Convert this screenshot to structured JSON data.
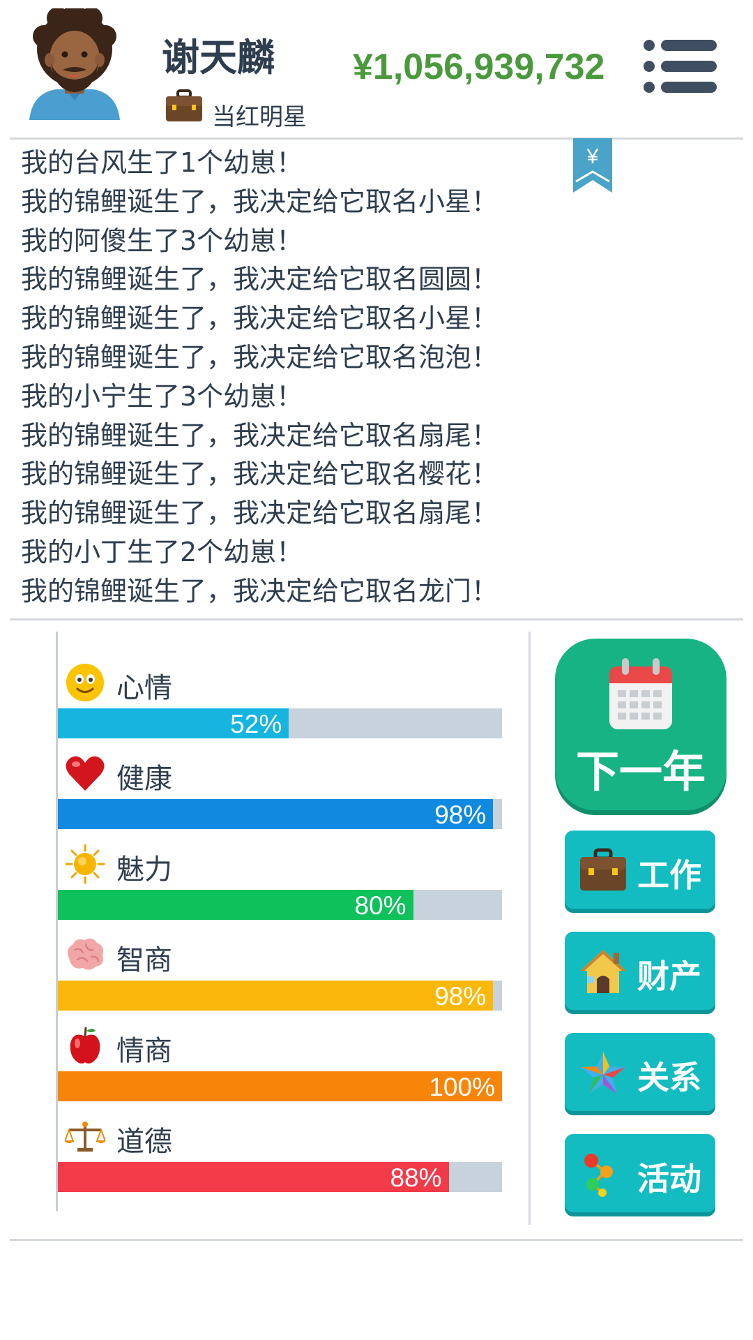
{
  "header": {
    "player_name": "谢天麟",
    "job_title": "当红明星",
    "money": "¥1,056,939,732",
    "avatar_icon": "avatar-icon",
    "job_icon": "briefcase-icon",
    "menu_icon": "menu-icon"
  },
  "log": {
    "bookmark_symbol": "¥",
    "lines": [
      "我的台风生了1个幼崽！",
      "我的锦鲤诞生了，我决定给它取名小星！",
      "我的阿傻生了3个幼崽！",
      "我的锦鲤诞生了，我决定给它取名圆圆！",
      "我的锦鲤诞生了，我决定给它取名小星！",
      "我的锦鲤诞生了，我决定给它取名泡泡！",
      "我的小宁生了3个幼崽！",
      "我的锦鲤诞生了，我决定给它取名扇尾！",
      "我的锦鲤诞生了，我决定给它取名樱花！",
      "我的锦鲤诞生了，我决定给它取名扇尾！",
      "我的小丁生了2个幼崽！",
      "我的锦鲤诞生了，我决定给它取名龙门！"
    ]
  },
  "stats": [
    {
      "label": "心情",
      "value": 52,
      "value_text": "52%",
      "color": "#16b5e0",
      "icon": "smiley-icon"
    },
    {
      "label": "健康",
      "value": 98,
      "value_text": "98%",
      "color": "#0f8ae0",
      "icon": "heart-icon"
    },
    {
      "label": "魅力",
      "value": 80,
      "value_text": "80%",
      "color": "#0ec15a",
      "icon": "sun-icon"
    },
    {
      "label": "智商",
      "value": 98,
      "value_text": "98%",
      "color": "#fbb80a",
      "icon": "brain-icon"
    },
    {
      "label": "情商",
      "value": 100,
      "value_text": "100%",
      "color": "#f7850a",
      "icon": "apple-icon"
    },
    {
      "label": "道德",
      "value": 88,
      "value_text": "88%",
      "color": "#f23a48",
      "icon": "scales-icon"
    }
  ],
  "actions": {
    "next_year": {
      "label": "下一年",
      "icon": "calendar-icon"
    },
    "buttons": [
      {
        "label": "工作",
        "icon": "briefcase-icon"
      },
      {
        "label": "财产",
        "icon": "house-icon"
      },
      {
        "label": "关系",
        "icon": "star-icon"
      },
      {
        "label": "活动",
        "icon": "activity-icon"
      }
    ]
  },
  "colors": {
    "money": "#4a9a3d",
    "text": "#2f3e4e",
    "next_year_bg": "#17b384",
    "action_bg": "#13bcc0",
    "track": "#c8d2dc"
  }
}
